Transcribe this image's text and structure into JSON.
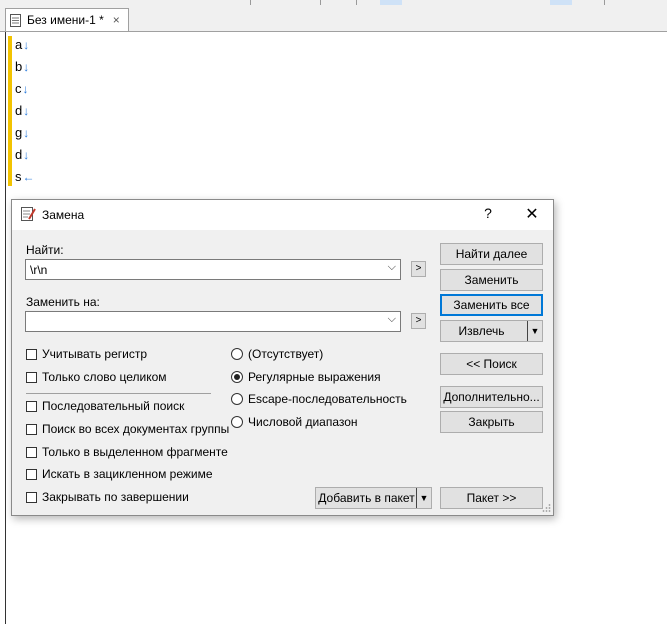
{
  "tab": {
    "title": "Без имени-1 *",
    "close": "×"
  },
  "editor": {
    "lines": [
      {
        "text": "a",
        "mark": "↓"
      },
      {
        "text": "b",
        "mark": "↓"
      },
      {
        "text": "c",
        "mark": "↓"
      },
      {
        "text": "d",
        "mark": "↓"
      },
      {
        "text": "g",
        "mark": "↓"
      },
      {
        "text": "d",
        "mark": "↓"
      },
      {
        "text": "s",
        "mark": "←"
      }
    ]
  },
  "dialog": {
    "title": "Замена",
    "help": "?",
    "close": "✕",
    "find_label": "Найти:",
    "find_value": "\\r\\n",
    "replace_label": "Заменить на:",
    "replace_value": "",
    "chevron": "⌵",
    "arrow": ">",
    "buttons": {
      "find_next": "Найти далее",
      "replace": "Заменить",
      "replace_all": "Заменить все",
      "extract": "Извлечь",
      "search": "<< Поиск",
      "more": "Дополнительно...",
      "close": "Закрыть",
      "add_to_batch": "Добавить в пакет",
      "batch": "Пакет >>"
    },
    "checkboxes": [
      "Учитывать регистр",
      "Только слово целиком",
      "Последовательный поиск",
      "Поиск во всех документах группы",
      "Только в выделенном фрагменте",
      "Искать в зацикленном режиме",
      "Закрывать по завершении"
    ],
    "radios": [
      {
        "label": "(Отсутствует)",
        "selected": false
      },
      {
        "label": "Регулярные выражения",
        "selected": true
      },
      {
        "label": "Escape-последовательность",
        "selected": false
      },
      {
        "label": "Числовой диапазон",
        "selected": false
      }
    ]
  },
  "colors": {
    "accent": "#0078d7",
    "gutter": "#f2c300",
    "eol_mark": "#2b7bdc"
  }
}
